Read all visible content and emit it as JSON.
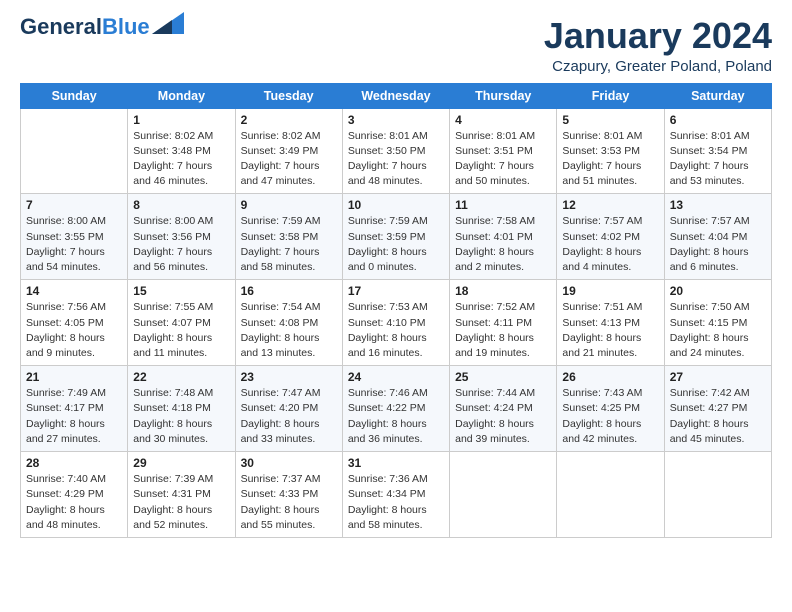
{
  "header": {
    "logo_line1": "General",
    "logo_line2": "Blue",
    "month_title": "January 2024",
    "location": "Czapury, Greater Poland, Poland"
  },
  "weekdays": [
    "Sunday",
    "Monday",
    "Tuesday",
    "Wednesday",
    "Thursday",
    "Friday",
    "Saturday"
  ],
  "weeks": [
    [
      {
        "day": "",
        "info": ""
      },
      {
        "day": "1",
        "info": "Sunrise: 8:02 AM\nSunset: 3:48 PM\nDaylight: 7 hours\nand 46 minutes."
      },
      {
        "day": "2",
        "info": "Sunrise: 8:02 AM\nSunset: 3:49 PM\nDaylight: 7 hours\nand 47 minutes."
      },
      {
        "day": "3",
        "info": "Sunrise: 8:01 AM\nSunset: 3:50 PM\nDaylight: 7 hours\nand 48 minutes."
      },
      {
        "day": "4",
        "info": "Sunrise: 8:01 AM\nSunset: 3:51 PM\nDaylight: 7 hours\nand 50 minutes."
      },
      {
        "day": "5",
        "info": "Sunrise: 8:01 AM\nSunset: 3:53 PM\nDaylight: 7 hours\nand 51 minutes."
      },
      {
        "day": "6",
        "info": "Sunrise: 8:01 AM\nSunset: 3:54 PM\nDaylight: 7 hours\nand 53 minutes."
      }
    ],
    [
      {
        "day": "7",
        "info": "Sunrise: 8:00 AM\nSunset: 3:55 PM\nDaylight: 7 hours\nand 54 minutes."
      },
      {
        "day": "8",
        "info": "Sunrise: 8:00 AM\nSunset: 3:56 PM\nDaylight: 7 hours\nand 56 minutes."
      },
      {
        "day": "9",
        "info": "Sunrise: 7:59 AM\nSunset: 3:58 PM\nDaylight: 7 hours\nand 58 minutes."
      },
      {
        "day": "10",
        "info": "Sunrise: 7:59 AM\nSunset: 3:59 PM\nDaylight: 8 hours\nand 0 minutes."
      },
      {
        "day": "11",
        "info": "Sunrise: 7:58 AM\nSunset: 4:01 PM\nDaylight: 8 hours\nand 2 minutes."
      },
      {
        "day": "12",
        "info": "Sunrise: 7:57 AM\nSunset: 4:02 PM\nDaylight: 8 hours\nand 4 minutes."
      },
      {
        "day": "13",
        "info": "Sunrise: 7:57 AM\nSunset: 4:04 PM\nDaylight: 8 hours\nand 6 minutes."
      }
    ],
    [
      {
        "day": "14",
        "info": "Sunrise: 7:56 AM\nSunset: 4:05 PM\nDaylight: 8 hours\nand 9 minutes."
      },
      {
        "day": "15",
        "info": "Sunrise: 7:55 AM\nSunset: 4:07 PM\nDaylight: 8 hours\nand 11 minutes."
      },
      {
        "day": "16",
        "info": "Sunrise: 7:54 AM\nSunset: 4:08 PM\nDaylight: 8 hours\nand 13 minutes."
      },
      {
        "day": "17",
        "info": "Sunrise: 7:53 AM\nSunset: 4:10 PM\nDaylight: 8 hours\nand 16 minutes."
      },
      {
        "day": "18",
        "info": "Sunrise: 7:52 AM\nSunset: 4:11 PM\nDaylight: 8 hours\nand 19 minutes."
      },
      {
        "day": "19",
        "info": "Sunrise: 7:51 AM\nSunset: 4:13 PM\nDaylight: 8 hours\nand 21 minutes."
      },
      {
        "day": "20",
        "info": "Sunrise: 7:50 AM\nSunset: 4:15 PM\nDaylight: 8 hours\nand 24 minutes."
      }
    ],
    [
      {
        "day": "21",
        "info": "Sunrise: 7:49 AM\nSunset: 4:17 PM\nDaylight: 8 hours\nand 27 minutes."
      },
      {
        "day": "22",
        "info": "Sunrise: 7:48 AM\nSunset: 4:18 PM\nDaylight: 8 hours\nand 30 minutes."
      },
      {
        "day": "23",
        "info": "Sunrise: 7:47 AM\nSunset: 4:20 PM\nDaylight: 8 hours\nand 33 minutes."
      },
      {
        "day": "24",
        "info": "Sunrise: 7:46 AM\nSunset: 4:22 PM\nDaylight: 8 hours\nand 36 minutes."
      },
      {
        "day": "25",
        "info": "Sunrise: 7:44 AM\nSunset: 4:24 PM\nDaylight: 8 hours\nand 39 minutes."
      },
      {
        "day": "26",
        "info": "Sunrise: 7:43 AM\nSunset: 4:25 PM\nDaylight: 8 hours\nand 42 minutes."
      },
      {
        "day": "27",
        "info": "Sunrise: 7:42 AM\nSunset: 4:27 PM\nDaylight: 8 hours\nand 45 minutes."
      }
    ],
    [
      {
        "day": "28",
        "info": "Sunrise: 7:40 AM\nSunset: 4:29 PM\nDaylight: 8 hours\nand 48 minutes."
      },
      {
        "day": "29",
        "info": "Sunrise: 7:39 AM\nSunset: 4:31 PM\nDaylight: 8 hours\nand 52 minutes."
      },
      {
        "day": "30",
        "info": "Sunrise: 7:37 AM\nSunset: 4:33 PM\nDaylight: 8 hours\nand 55 minutes."
      },
      {
        "day": "31",
        "info": "Sunrise: 7:36 AM\nSunset: 4:34 PM\nDaylight: 8 hours\nand 58 minutes."
      },
      {
        "day": "",
        "info": ""
      },
      {
        "day": "",
        "info": ""
      },
      {
        "day": "",
        "info": ""
      }
    ]
  ]
}
